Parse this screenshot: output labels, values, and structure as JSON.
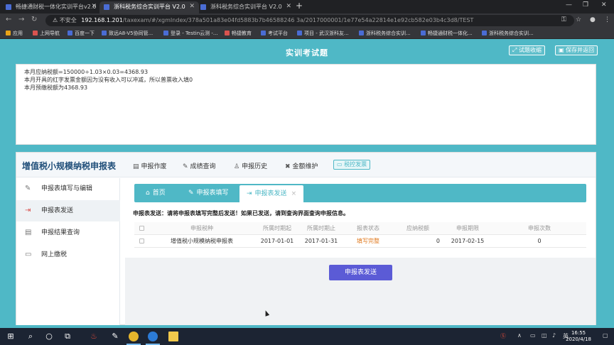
{
  "browser": {
    "tabs": [
      {
        "title": "畅捷通财税一体化实训平台v2.0",
        "active": false
      },
      {
        "title": "浙科税务综合实训平台 V2.0",
        "active": true
      },
      {
        "title": "浙科税务综合实训平台 V2.0",
        "active": false
      }
    ],
    "insecure_label": "不安全",
    "url_host": "192.168.1.201",
    "url_path": "/taxexam/#/xgmIndex/378a501a83e04fd5883b7b46588246 3a/2017000001/1e77e54a22814e1e92cb582e03b4c3d8/TEST",
    "bookmarks": [
      {
        "label": "应用",
        "icon": "grid"
      },
      {
        "label": "上网导航",
        "icon": "red"
      },
      {
        "label": "百度一下",
        "icon": "blue"
      },
      {
        "label": "致远A8-V5协同管...",
        "icon": "blue"
      },
      {
        "label": "登录 - Testin云测 -...",
        "icon": "blue"
      },
      {
        "label": "畅捷教育",
        "icon": "red"
      },
      {
        "label": "考试平台",
        "icon": "blue"
      },
      {
        "label": "项目 - 武汉浙科友...",
        "icon": "blue"
      },
      {
        "label": "浙科税务综合实训...",
        "icon": "blue"
      },
      {
        "label": "畅捷通财税一体化...",
        "icon": "blue"
      },
      {
        "label": "浙科税务综合实训...",
        "icon": "blue"
      }
    ]
  },
  "app": {
    "title": "实训考试题",
    "btn_collapse": "试题收缩",
    "btn_save_return": "保存并返回"
  },
  "notes": [
    "本月应纳税额=150000÷1.03×0.03=4368.93",
    "本月开具的红字发票金额因为没有收入可以冲减，所以普票收入填0",
    "本月预缴税额为4368.93"
  ],
  "form": {
    "title": "增值税小规模纳税申报表",
    "topnav": [
      {
        "label": "申报作废",
        "icon": "doc-icon"
      },
      {
        "label": "成绩查询",
        "icon": "edit-icon"
      },
      {
        "label": "申报历史",
        "icon": "user-icon"
      },
      {
        "label": "金额维护",
        "icon": "tools-icon"
      }
    ],
    "tax_control_label": "税控发票",
    "sidebar": [
      {
        "label": "申报表填写与编辑",
        "icon": "edit-icon",
        "active": false
      },
      {
        "label": "申报表发送",
        "icon": "send-icon",
        "active": true
      },
      {
        "label": "申报结果查询",
        "icon": "doc-icon",
        "active": false
      },
      {
        "label": "网上缴税",
        "icon": "monitor-icon",
        "active": false
      }
    ],
    "content_tabs": [
      {
        "label": "首页",
        "icon": "home-icon"
      },
      {
        "label": "申报表填写",
        "icon": "edit-icon"
      },
      {
        "label": "申报表发送",
        "icon": "send-icon",
        "active": true
      }
    ],
    "tab_close": "×",
    "notice": "申报表发送：请将申报表填写完整后发送！如果已发送，请到查询界面查询申报信息。",
    "table": {
      "headers": [
        "申报税种",
        "所属时期起",
        "所属时期止",
        "报表状态",
        "应纳税额",
        "申报期限",
        "申报次数"
      ],
      "rows": [
        [
          "增值税小规模纳税申报表",
          "2017-01-01",
          "2017-01-31",
          "填写完整",
          "0",
          "2017-02-15",
          "0"
        ]
      ]
    },
    "send_button": "申报表发送"
  },
  "taskbar": {
    "time": "16:55",
    "date": "2020/4/18",
    "ime": "英"
  },
  "colors": {
    "accent": "#4fb8c6",
    "primary_button": "#5b5bd6",
    "status_orange": "#e07a1f",
    "title_blue": "#1f4e79"
  }
}
